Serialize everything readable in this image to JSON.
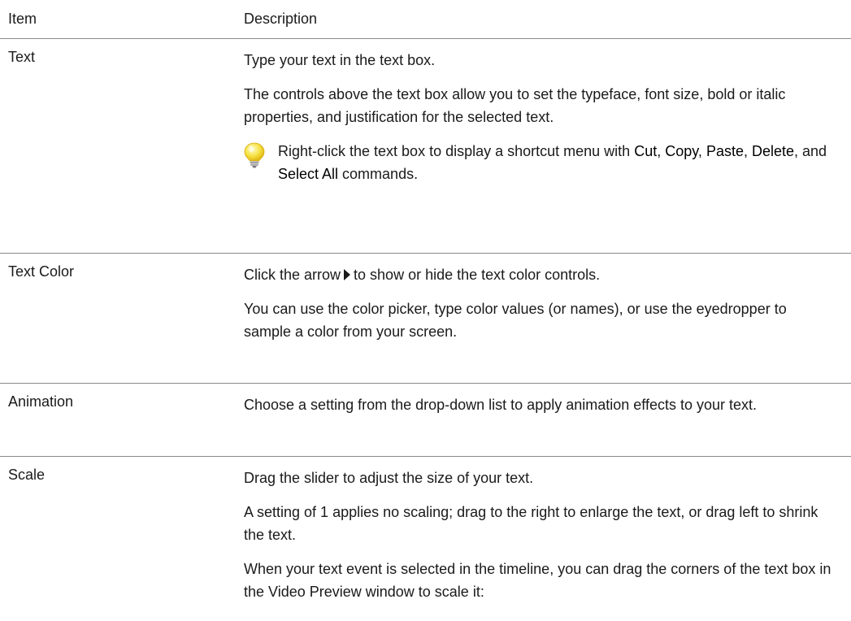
{
  "table": {
    "header": {
      "item": "Item",
      "description": "Description"
    },
    "rows": [
      {
        "item": "Text",
        "p1": "Type your text in the text box.",
        "p2": "The controls above the text box allow you to set the typeface, font size, bold or italic properties, and justification for the selected text.",
        "tip": {
          "icon": "lightbulb-icon",
          "t1": "Right-click the text box to display a shortcut menu with ",
          "cut": "Cut",
          "sep1": ", ",
          "copy": "Copy",
          "sep2": ", ",
          "paste": "Paste",
          "sep3": ", ",
          "delete": "Delete",
          "sep4": ", and ",
          "select_all": "Select All",
          "t2": " commands."
        }
      },
      {
        "item": "Text Color",
        "p1_before": "Click the arrow",
        "p1_icon": "expand-arrow-icon",
        "p1_after": "to show or hide the text color controls.",
        "p2": "You can use the color picker, type color values (or names), or use the eyedropper to sample a color from your screen."
      },
      {
        "item": "Animation",
        "p1": "Choose a setting from the drop-down list to apply animation effects to your text."
      },
      {
        "item": "Scale",
        "p1": "Drag the slider to adjust the size of your text.",
        "p2": "A setting of 1 applies no scaling; drag to the right to enlarge the text, or drag left to shrink the text.",
        "p3": "When your text event is selected in the timeline, you can drag the corners of the text box in the Video Preview window to scale it:"
      }
    ]
  }
}
